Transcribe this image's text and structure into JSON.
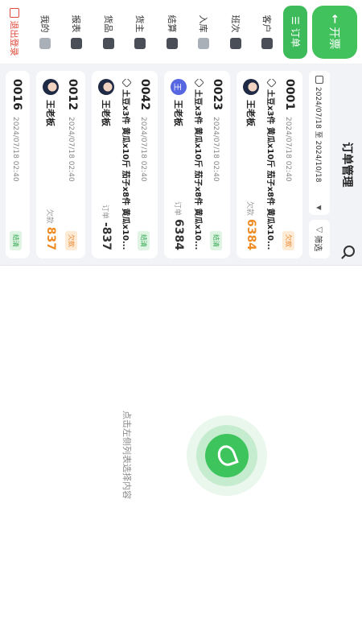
{
  "nav": {
    "create_button": "开票",
    "orders_button": "订单",
    "items": [
      {
        "label": "客户",
        "icon": "customer-icon"
      },
      {
        "label": "班次",
        "icon": "shift-icon"
      },
      {
        "label": "入库",
        "icon": "warehouse-icon"
      },
      {
        "label": "结算",
        "icon": "settlement-icon"
      },
      {
        "label": "货主",
        "icon": "owner-icon"
      },
      {
        "label": "货品",
        "icon": "goods-icon"
      },
      {
        "label": "报表",
        "icon": "report-icon"
      },
      {
        "label": "我的",
        "icon": "profile-icon"
      }
    ],
    "logout": "退出登录"
  },
  "list": {
    "title": "订单管理",
    "date_range": "2024/07/18 至 2024/10/18",
    "filter_label": "筛选",
    "orders": [
      {
        "no": "0001",
        "time": "2024/07/18 02:40",
        "badge": "欠款",
        "items": "土豆x3件  黄瓜x10斤  茄子x8件  黄瓜x10...",
        "customer": "王老板",
        "amount_label": "欠款",
        "amount": "6384"
      },
      {
        "no": "0023",
        "time": "2024/07/18 02:40",
        "badge": "结清",
        "items": "土豆x3件  黄瓜x10斤  茄子x8件  黄瓜x10...",
        "customer": "王老板",
        "amount_label": "订单",
        "amount": "6384"
      },
      {
        "no": "0042",
        "time": "2024/07/18 02:40",
        "badge": "结清",
        "items": "土豆x3件  黄瓜x10斤  茄子x8件  黄瓜x10...",
        "customer": "王老板",
        "amount_label": "订单",
        "amount": "-837"
      },
      {
        "no": "0012",
        "time": "2024/07/18 02:40",
        "badge": "欠款",
        "items": "",
        "customer": "王老板",
        "amount_label": "欠款",
        "amount": "837"
      },
      {
        "no": "0016",
        "time": "2024/07/18 02:40",
        "badge": "结清"
      }
    ]
  },
  "detail": {
    "empty_text": "点击左侧列表选择内容"
  },
  "colors": {
    "brand_green": "#3dbb5a",
    "owe_orange": "#ee8a22",
    "logout_red": "#e04a3b"
  }
}
